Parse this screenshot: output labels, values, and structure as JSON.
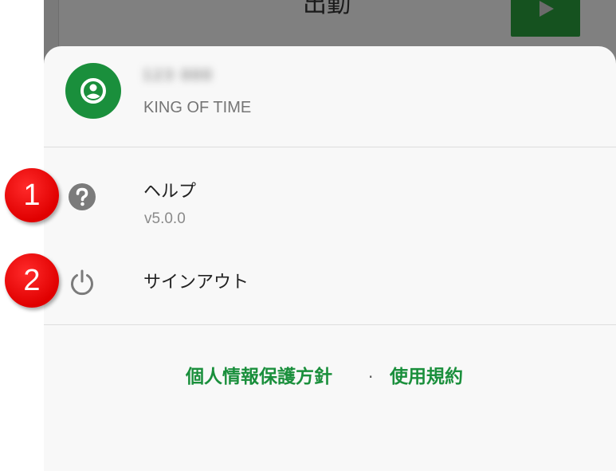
{
  "background_app": {
    "title": "出勤"
  },
  "profile": {
    "user_name": "123 000",
    "company": "KING OF TIME"
  },
  "menu": {
    "help": {
      "label": "ヘルプ",
      "version": "v5.0.0"
    },
    "signout": {
      "label": "サインアウト"
    }
  },
  "footer": {
    "privacy_policy": "個人情報保護方針",
    "separator": ".",
    "terms_of_use": "使用規約"
  },
  "annotations": {
    "badge_1": "1",
    "badge_2": "2"
  },
  "colors": {
    "accent_green": "#1a8f3c",
    "badge_red": "#e00000",
    "icon_gray": "#757575"
  }
}
